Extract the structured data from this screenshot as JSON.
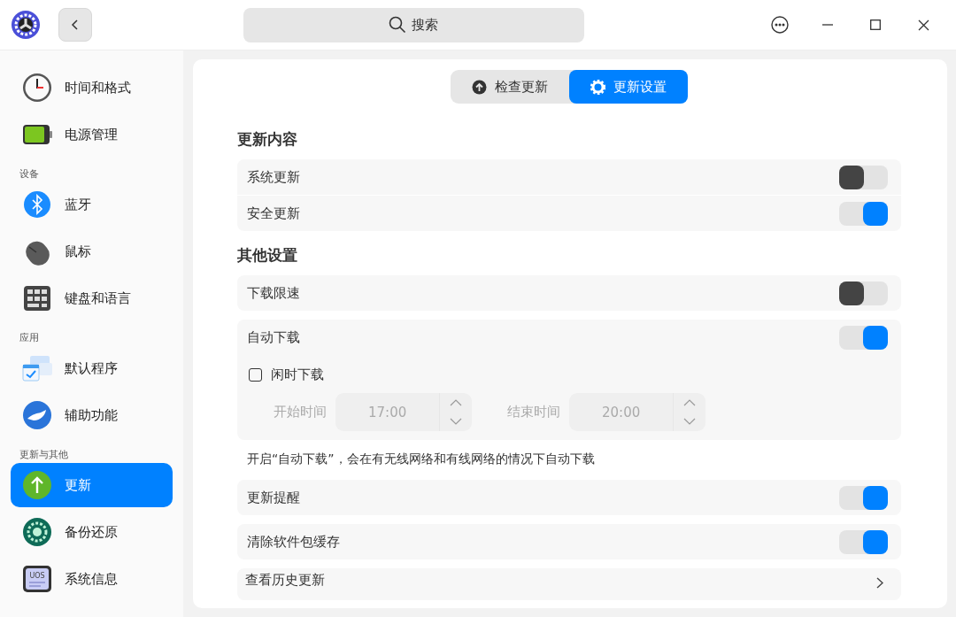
{
  "window": {
    "search": {
      "placeholder": "搜索"
    }
  },
  "sidebar": {
    "items": [
      {
        "kind": "item",
        "label": "时间和格式",
        "selected": false
      },
      {
        "kind": "item",
        "label": "电源管理",
        "selected": false
      },
      {
        "kind": "header",
        "label": "设备"
      },
      {
        "kind": "item",
        "label": "蓝牙",
        "selected": false
      },
      {
        "kind": "item",
        "label": "鼠标",
        "selected": false
      },
      {
        "kind": "item",
        "label": "键盘和语言",
        "selected": false
      },
      {
        "kind": "header",
        "label": "应用"
      },
      {
        "kind": "item",
        "label": "默认程序",
        "selected": false
      },
      {
        "kind": "item",
        "label": "辅助功能",
        "selected": false
      },
      {
        "kind": "header",
        "label": "更新与其他"
      },
      {
        "kind": "item",
        "label": "更新",
        "selected": true
      },
      {
        "kind": "item",
        "label": "备份还原",
        "selected": false
      },
      {
        "kind": "item",
        "label": "系统信息",
        "selected": false,
        "icon_text": "UOS"
      }
    ]
  },
  "tabs": [
    {
      "label": "检查更新",
      "selected": false
    },
    {
      "label": "更新设置",
      "selected": true
    }
  ],
  "settings": [
    {
      "kind": "heading",
      "text": "更新内容"
    },
    {
      "kind": "group",
      "rows": [
        {
          "kind": "toggle",
          "label": "系统更新",
          "on": false
        },
        {
          "kind": "toggle",
          "label": "安全更新",
          "on": true
        }
      ]
    },
    {
      "kind": "heading",
      "text": "其他设置"
    },
    {
      "kind": "group",
      "rows": [
        {
          "kind": "toggle",
          "label": "下载限速",
          "on": false
        }
      ]
    },
    {
      "kind": "group",
      "rows": [
        {
          "kind": "toggle",
          "label": "自动下载",
          "on": true
        },
        {
          "kind": "idle",
          "label": "闲时下载",
          "checked": false,
          "start_label": "开始时间",
          "start": "17:00",
          "end_label": "结束时间",
          "end": "20:00"
        }
      ]
    },
    {
      "kind": "note",
      "text": "开启“自动下载”，会在有无线网络和有线网络的情况下自动下载"
    },
    {
      "kind": "group",
      "rows": [
        {
          "kind": "toggle",
          "label": "更新提醒",
          "on": true
        }
      ]
    },
    {
      "kind": "group",
      "rows": [
        {
          "kind": "toggle",
          "label": "清除软件包缓存",
          "on": true
        }
      ]
    },
    {
      "kind": "group",
      "rows": [
        {
          "kind": "link",
          "label": "查看历史更新"
        }
      ]
    }
  ]
}
